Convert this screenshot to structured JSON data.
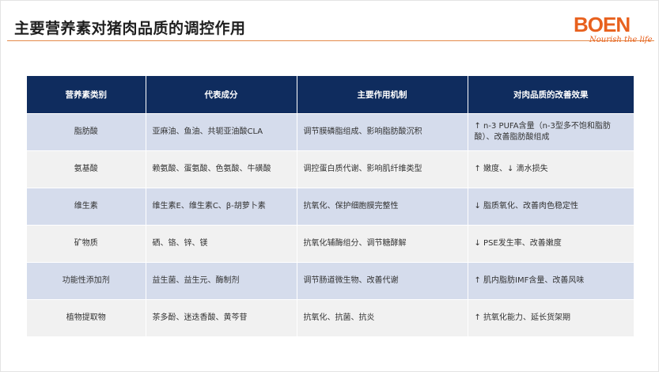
{
  "slide": {
    "title": "主要营养素对猪肉品质的调控作用",
    "logo": {
      "word": "BOEN",
      "tagline": "Nourish the life"
    }
  },
  "colors": {
    "header_bg": "#0f2c5e",
    "row_odd": "#d5dcec",
    "row_even": "#f1f1f1",
    "accent": "#e8611e"
  },
  "table": {
    "headers": [
      "营养素类别",
      "代表成分",
      "主要作用机制",
      "对肉品质的改善效果"
    ],
    "rows": [
      [
        "脂肪酸",
        "亚麻油、鱼油、共轭亚油酸CLA",
        "调节膜磷脂组成、影响脂肪酸沉积",
        "↑ n-3 PUFA含量（n-3型多不饱和脂肪酸）、改善脂肪酸组成"
      ],
      [
        "氨基酸",
        "赖氨酸、蛋氨酸、色氨酸、牛磺酸",
        "调控蛋白质代谢、影响肌纤维类型",
        "↑ 嫩度、↓ 滴水损失"
      ],
      [
        "维生素",
        "维生素E、维生素C、β-胡萝卜素",
        "抗氧化、保护细胞膜完整性",
        "↓ 脂质氧化、改善肉色稳定性"
      ],
      [
        "矿物质",
        "硒、铬、锌、镁",
        "抗氧化辅酶组分、调节糖酵解",
        "↓ PSE发生率、改善嫩度"
      ],
      [
        "功能性添加剂",
        "益生菌、益生元、酶制剂",
        "调节肠道微生物、改善代谢",
        "↑ 肌内脂肪IMF含量、改善风味"
      ],
      [
        "植物提取物",
        "茶多酚、迷迭香酸、黄芩苷",
        "抗氧化、抗菌、抗炎",
        "↑ 抗氧化能力、延长货架期"
      ]
    ]
  }
}
